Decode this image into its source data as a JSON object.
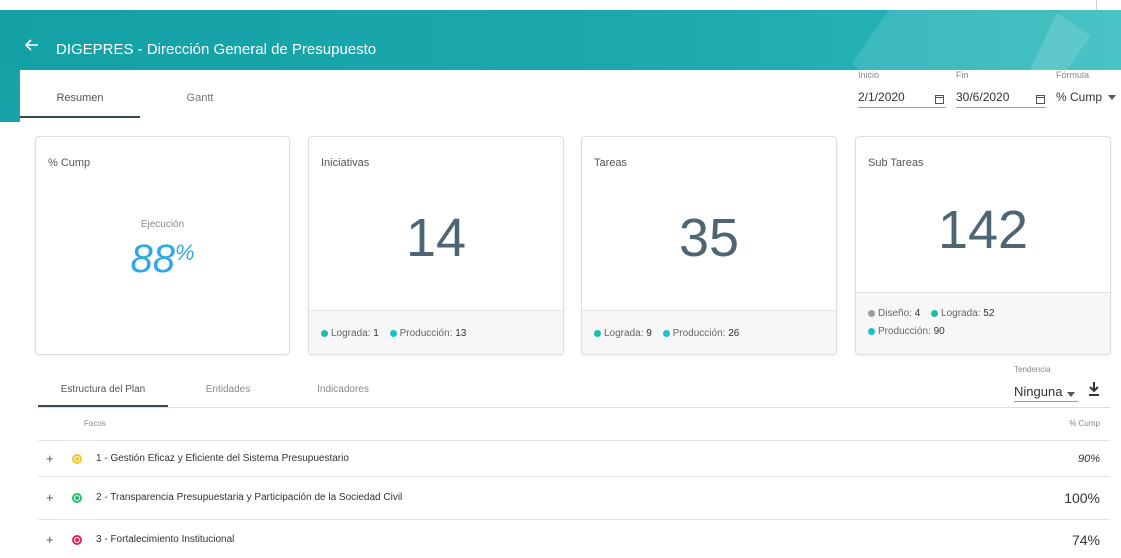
{
  "header": {
    "title": "DIGEPRES - Dirección General de Presupuesto",
    "back_icon": "arrow-left-icon",
    "accent_color": "#1ba9ad"
  },
  "top_tabs": [
    {
      "label": "Resumen",
      "active": true
    },
    {
      "label": "Gantt",
      "active": false
    }
  ],
  "filters": {
    "inicio": {
      "label": "Inicio",
      "value": "2/1/2020"
    },
    "fin": {
      "label": "Fin",
      "value": "30/6/2020"
    },
    "formula": {
      "label": "Fórmula",
      "value": "% Cump"
    }
  },
  "cards": {
    "cump": {
      "title": "% Cump",
      "sub_label": "Ejecución",
      "value": "88",
      "unit": "%",
      "value_color": "#2fa8e6"
    },
    "iniciativas": {
      "title": "Iniciativas",
      "value": "14",
      "legend": [
        {
          "label": "Lograda:",
          "value": "1",
          "color": "#1bbfa8"
        },
        {
          "label": "Producción:",
          "value": "13",
          "color": "#1bc3c9"
        }
      ]
    },
    "tareas": {
      "title": "Tareas",
      "value": "35",
      "legend": [
        {
          "label": "Lograda:",
          "value": "9",
          "color": "#1bbfa8"
        },
        {
          "label": "Producción:",
          "value": "26",
          "color": "#1bc3c9"
        }
      ]
    },
    "subtareas": {
      "title": "Sub Tareas",
      "value": "142",
      "legend": [
        {
          "label": "Diseño:",
          "value": "4",
          "color": "#9e9e9e"
        },
        {
          "label": "Lograda:",
          "value": "52",
          "color": "#1bbfa8"
        },
        {
          "label": "Producción:",
          "value": "90",
          "color": "#1bc3c9"
        }
      ]
    }
  },
  "section_tabs": [
    {
      "label": "Estructura del Plan",
      "active": true
    },
    {
      "label": "Entidades",
      "active": false
    },
    {
      "label": "Indicadores",
      "active": false
    }
  ],
  "tendencia": {
    "label": "Tendencia",
    "value": "Ninguna"
  },
  "table": {
    "col_focos": "Focos",
    "col_cump": "% Cump",
    "rows": [
      {
        "label": "1 - Gestión Eficaz y Eficiente del Sistema Presupuestario",
        "value": "90%",
        "color": "#f3c623",
        "italic": true
      },
      {
        "label": "2 - Transparencia Presupuestaria y Participación de la Sociedad Civil",
        "value": "100%",
        "color": "#27c26a",
        "italic": false
      },
      {
        "label": "3 - Fortalecimiento Institucional",
        "value": "74%",
        "color": "#e5265b",
        "italic": false
      }
    ]
  }
}
